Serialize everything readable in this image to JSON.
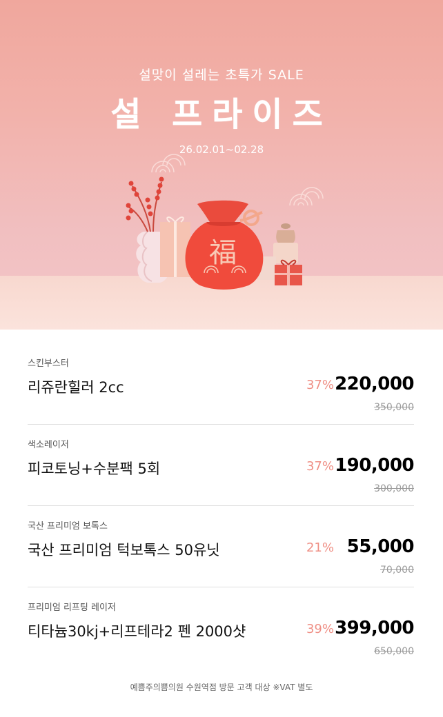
{
  "banner": {
    "subtitle": "설맞이 설레는 초특가 SALE",
    "title": "설 프라이즈",
    "period": "26.02.01~02.28",
    "bag_char": "福",
    "colors": {
      "bag": "#f04b3c",
      "accent": "#ef8f85"
    }
  },
  "items": [
    {
      "category": "스킨부스터",
      "name": "리쥬란힐러 2cc",
      "discount": "37%",
      "price": "220,000",
      "original": "350,000"
    },
    {
      "category": "색소레이저",
      "name": "피코토닝+수분팩 5회",
      "discount": "37%",
      "price": "190,000",
      "original": "300,000"
    },
    {
      "category": "국산 프리미엄 보톡스",
      "name": "국산 프리미엄 턱보톡스 50유닛",
      "discount": "21%",
      "price": "55,000",
      "original": "70,000"
    },
    {
      "category": "프리미엄 리프팅 레이저",
      "name": "티타늄30kj+리프테라2 펜 2000샷",
      "discount": "39%",
      "price": "399,000",
      "original": "650,000"
    }
  ],
  "footnote": "예쁨주의쁨의원 수원역점 방문 고객 대상 ※VAT 별도"
}
